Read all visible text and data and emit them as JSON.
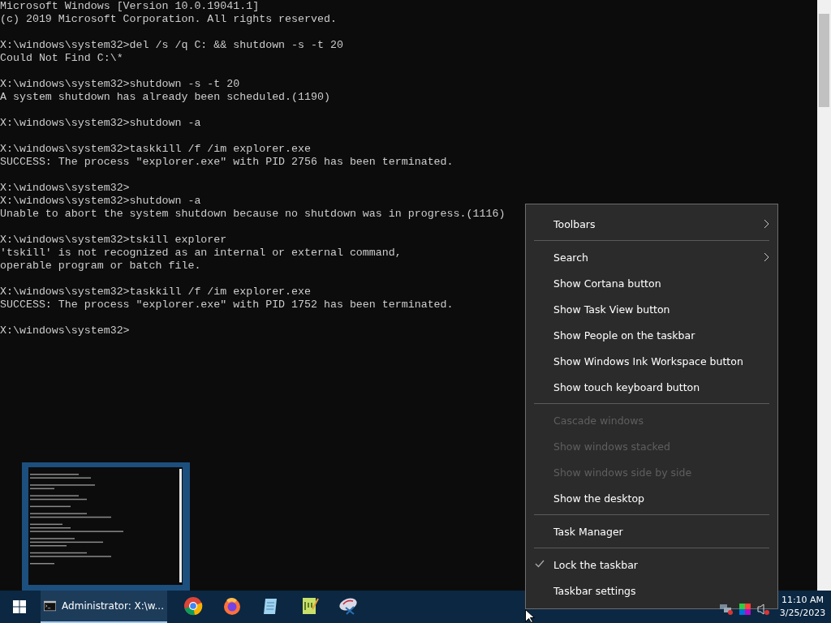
{
  "console": {
    "blocks": [
      [
        "Microsoft Windows [Version 10.0.19041.1]",
        "(c) 2019 Microsoft Corporation. All rights reserved."
      ],
      [
        "X:\\windows\\system32>del /s /q C: && shutdown -s -t 20",
        "Could Not Find C:\\*"
      ],
      [
        "X:\\windows\\system32>shutdown -s -t 20",
        "A system shutdown has already been scheduled.(1190)"
      ],
      [
        "X:\\windows\\system32>shutdown -a"
      ],
      [
        "X:\\windows\\system32>taskkill /f /im explorer.exe",
        "SUCCESS: The process \"explorer.exe\" with PID 2756 has been terminated."
      ],
      [
        "X:\\windows\\system32>",
        "X:\\windows\\system32>shutdown -a",
        "Unable to abort the system shutdown because no shutdown was in progress.(1116)"
      ],
      [
        "X:\\windows\\system32>tskill explorer",
        "'tskill' is not recognized as an internal or external command,",
        "operable program or batch file."
      ],
      [
        "X:\\windows\\system32>taskkill /f /im explorer.exe",
        "SUCCESS: The process \"explorer.exe\" with PID 1752 has been terminated."
      ],
      [
        "X:\\windows\\system32>"
      ]
    ]
  },
  "context_menu": {
    "items": [
      {
        "kind": "item",
        "label": "Toolbars",
        "submenu": true,
        "disabled": false,
        "checked": false
      },
      {
        "kind": "separator"
      },
      {
        "kind": "item",
        "label": "Search",
        "submenu": true,
        "disabled": false,
        "checked": false
      },
      {
        "kind": "item",
        "label": "Show Cortana button",
        "submenu": false,
        "disabled": false,
        "checked": false
      },
      {
        "kind": "item",
        "label": "Show Task View button",
        "submenu": false,
        "disabled": false,
        "checked": false
      },
      {
        "kind": "item",
        "label": "Show People on the taskbar",
        "submenu": false,
        "disabled": false,
        "checked": false
      },
      {
        "kind": "item",
        "label": "Show Windows Ink Workspace button",
        "submenu": false,
        "disabled": false,
        "checked": false
      },
      {
        "kind": "item",
        "label": "Show touch keyboard button",
        "submenu": false,
        "disabled": false,
        "checked": false
      },
      {
        "kind": "separator"
      },
      {
        "kind": "item",
        "label": "Cascade windows",
        "submenu": false,
        "disabled": true,
        "checked": false
      },
      {
        "kind": "item",
        "label": "Show windows stacked",
        "submenu": false,
        "disabled": true,
        "checked": false
      },
      {
        "kind": "item",
        "label": "Show windows side by side",
        "submenu": false,
        "disabled": true,
        "checked": false
      },
      {
        "kind": "item",
        "label": "Show the desktop",
        "submenu": false,
        "disabled": false,
        "checked": false
      },
      {
        "kind": "separator"
      },
      {
        "kind": "item",
        "label": "Task Manager",
        "submenu": false,
        "disabled": false,
        "checked": false
      },
      {
        "kind": "separator"
      },
      {
        "kind": "item",
        "label": "Lock the taskbar",
        "submenu": false,
        "disabled": false,
        "checked": true
      },
      {
        "kind": "item",
        "label": "Taskbar settings",
        "submenu": false,
        "disabled": false,
        "checked": false
      }
    ]
  },
  "taskbar": {
    "apps": [
      {
        "kind": "console",
        "label": "Administrator: X:\\w...",
        "selected": true
      },
      {
        "kind": "chrome",
        "selected": false
      },
      {
        "kind": "firefox",
        "selected": false
      },
      {
        "kind": "notepad",
        "selected": false
      },
      {
        "kind": "notepadpp",
        "selected": false
      },
      {
        "kind": "snipping",
        "selected": false
      }
    ],
    "tray": [
      {
        "kind": "network"
      },
      {
        "kind": "color"
      },
      {
        "kind": "volume"
      }
    ],
    "clock": {
      "time": "11:10 AM",
      "date": "3/25/2023"
    }
  }
}
